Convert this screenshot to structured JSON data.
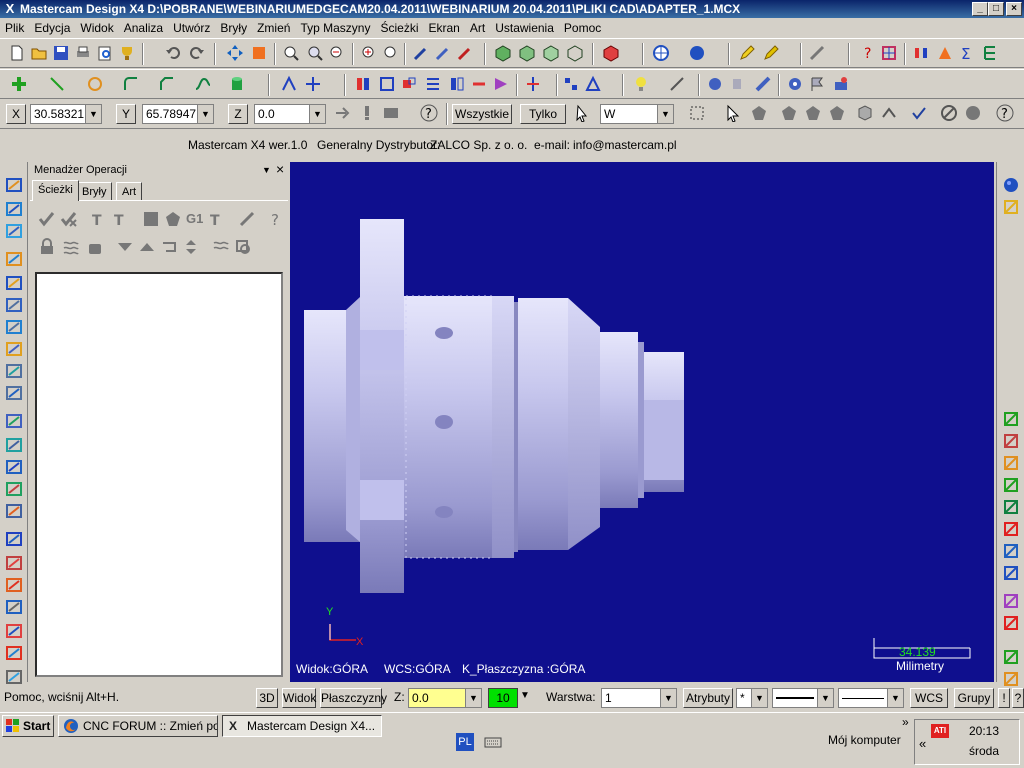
{
  "titlebar": {
    "title": "Mastercam Design X4  D:\\POBRANE\\WEBINARIUMEDGECAM20.04.2011\\WEBINARIUM 20.04.2011\\PLIKI CAD\\ADAPTER_1.MCX",
    "minimize": "_",
    "maximize": "□",
    "close": "×"
  },
  "menu": [
    "Plik",
    "Edycja",
    "Widok",
    "Analiza",
    "Utwórz",
    "Bryły",
    "Zmień",
    "Typ Maszyny",
    "Ścieżki",
    "Ekran",
    "Art",
    "Ustawienia",
    "Pomoc"
  ],
  "coords": {
    "x_label": "X",
    "x_value": "30.58321",
    "y_label": "Y",
    "y_value": "65.78947",
    "z_label": "Z",
    "z_value": "0.0",
    "all_button": "Wszystkie",
    "only_button": "Tylko",
    "filter_value": "W"
  },
  "info": {
    "version": "Mastercam X4 wer.1.0",
    "distributor_label": "Generalny Dystrybutor:",
    "distributor": "ZALCO Sp. z o. o.",
    "email_label": "e-mail:",
    "email": "info@mastercam.pl"
  },
  "opmanager": {
    "title": "Menadżer Operacji",
    "close": "×",
    "tabs": [
      "Ścieżki",
      "Bryły",
      "Art"
    ],
    "toolbar_g1": "G1"
  },
  "viewport": {
    "axis_y": "Y",
    "axis_x": "X",
    "view_label": "Widok:GÓRA",
    "wcs_label": "WCS:GÓRA",
    "plane_label": "K_Płaszczyzna :GÓRA",
    "scale_value": "34.139",
    "scale_unit": "Milimetry",
    "background_color": "#0f0f8e",
    "part_color": "#c8c8ee"
  },
  "statusbar": {
    "help": "Pomoc, wciśnij Alt+H.",
    "btn_3d": "3D",
    "btn_view": "Widok",
    "btn_plane": "Płaszczyzny",
    "z_label": "Z:",
    "z_value": "0.0",
    "color_value": "10",
    "layer_label": "Warstwa:",
    "layer_value": "1",
    "attributes": "Atrybuty",
    "point_style": "*",
    "wcs": "WCS",
    "groups": "Grupy",
    "excl": "!",
    "question": "?"
  },
  "taskbar": {
    "start": "Start",
    "tasks": [
      "CNC FORUM :: Zmień po...",
      "Mastercam Design X4..."
    ],
    "lang": "PL",
    "my_computer": "Mój komputer",
    "time": "20:13",
    "day": "środa",
    "chevron": "»",
    "double_chevron": "«"
  }
}
